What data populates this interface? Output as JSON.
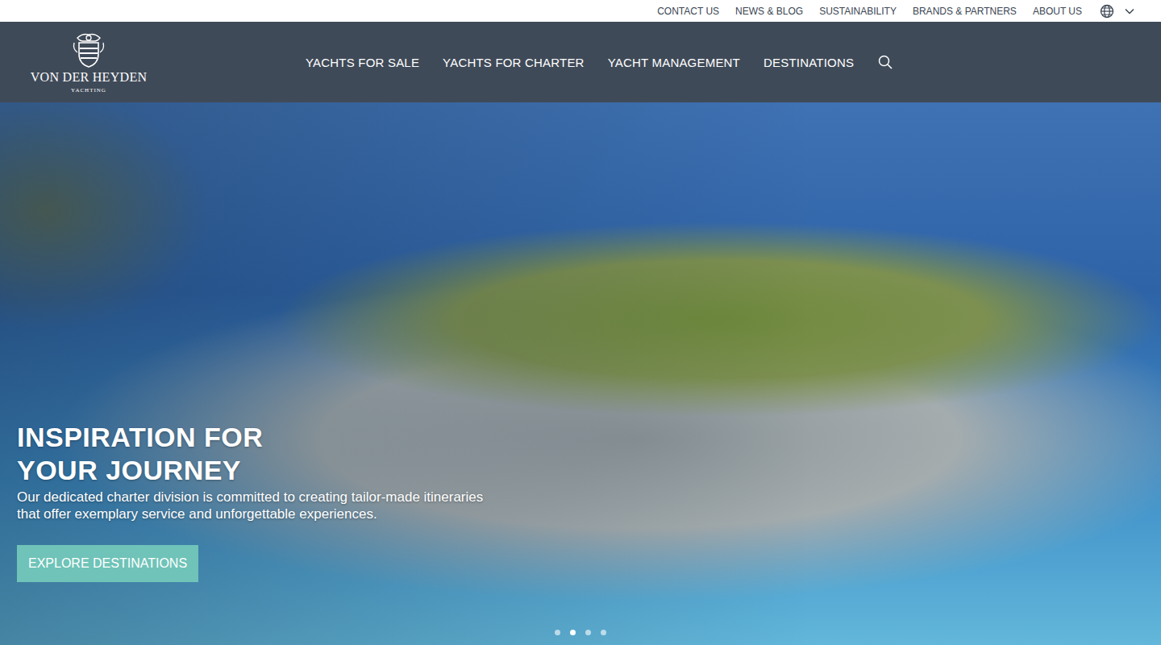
{
  "utility_bar": {
    "links": [
      "CONTACT US",
      "NEWS & BLOG",
      "SUSTAINABILITY",
      "BRANDS & PARTNERS",
      "ABOUT US"
    ]
  },
  "logo": {
    "name": "VON DER HEYDEN",
    "tagline": "YACHTING"
  },
  "main_nav": {
    "items": [
      "YACHTS FOR SALE",
      "YACHTS FOR CHARTER",
      "YACHT MANAGEMENT",
      "DESTINATIONS"
    ]
  },
  "hero": {
    "title_lines": [
      "INSPIRATION FOR",
      "YOUR JOURNEY"
    ],
    "text": "Our dedicated charter division is committed to creating tailor-made itineraries that offer exemplary service and unforgettable experiences.",
    "button": "EXPLORE DESTINATIONS"
  },
  "carousel": {
    "dots": [
      {
        "selected": false
      },
      {
        "selected": true
      },
      {
        "selected": false
      },
      {
        "selected": false
      }
    ]
  }
}
